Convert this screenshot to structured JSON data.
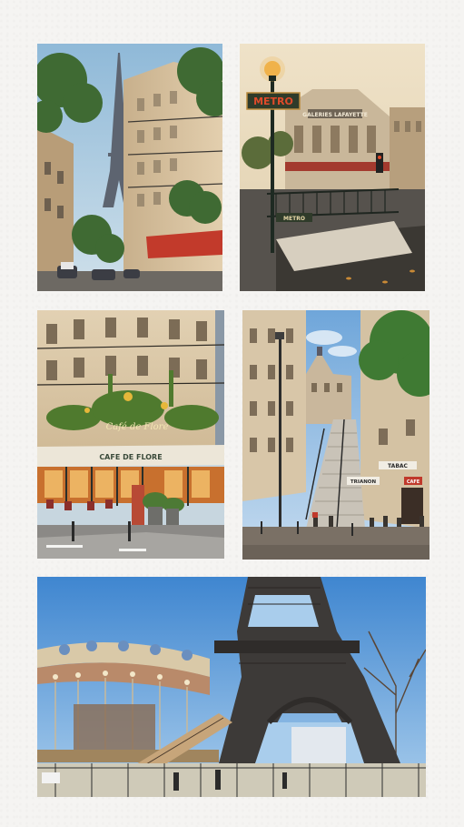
{
  "collage": {
    "photos": [
      {
        "subject": "eiffel-tower-street"
      },
      {
        "subject": "metro-entrance-galeries-lafayette"
      },
      {
        "subject": "cafe-de-flore"
      },
      {
        "subject": "montmartre-stairs"
      },
      {
        "subject": "eiffel-tower-carousel"
      }
    ]
  },
  "signs": {
    "metro": "METRO",
    "galeries": "GALERIES LAFAYETTE",
    "cafe_script": "Café de Flore",
    "cafe_awning": "CAFE DE FLORE",
    "tabac": "TABAC",
    "trianon": "TRIANON",
    "cafe_small": "CAFE",
    "metro_sub": "METRO"
  },
  "colors": {
    "background": "#f5f4f2",
    "sky": "#8fb8d6",
    "haussmann_stone": "#d9c6a5",
    "awning_red": "#c0392b",
    "metro_green": "#2f3b2a",
    "lamp_amber": "#f0b24a"
  }
}
